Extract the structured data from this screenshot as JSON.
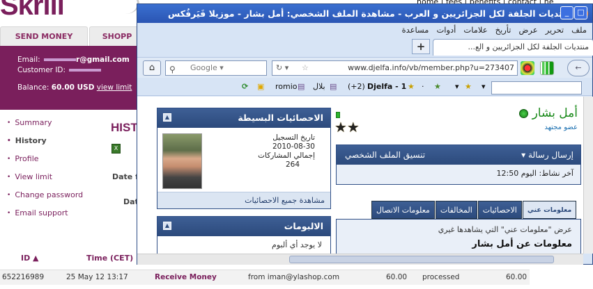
{
  "background": {
    "logo": "Skrill",
    "top_links": "home | fees | benefits | contact | he",
    "tabs": [
      "SEND MONEY",
      "SHOPP"
    ],
    "account": {
      "email_label": "Email:",
      "email_suffix": "r@gmail.com",
      "customer_label": "Customer ID:",
      "balance_label": "Balance:",
      "balance_value": "60.00 USD",
      "view_limit": "view limit"
    },
    "menu": [
      "Summary",
      "History",
      "Profile",
      "View limit",
      "Change password",
      "Email support"
    ],
    "page_title": "HIST",
    "date_from": "Date fr",
    "date_to": "Dat",
    "table_headers": {
      "id": "ID ▲",
      "time": "Time (CET)"
    },
    "row": {
      "id": "652216989",
      "time": "25 May 12 13:17",
      "type": "Receive Money",
      "detail": "from iman@ylashop.com",
      "amount": "60.00",
      "status": "processed",
      "balance": "60.00"
    }
  },
  "browser": {
    "title": "منتديات الجلفة لكل الجزائريين و العرب - مشاهدة الملف الشخصي: أمل بشار - موزيلا فَيَرفُكس",
    "menu": [
      "ملف",
      "تحرير",
      "عرض",
      "تأريخ",
      "علامات",
      "أدوات",
      "مساعدة"
    ],
    "tab_title": "منتديات الجلفة لكل الجزائريين و الع...",
    "new_tab": "+",
    "search_engine": "Google",
    "url": "www.djelfa.info/vb/member.php?u=273407",
    "bookmarks": {
      "romio": "romio",
      "bilal": "بلال",
      "count": "(+2)",
      "djelfa": "Djelfa - 1"
    }
  },
  "profile": {
    "stats_title": "الاحصائيات البسيطة",
    "join_label": "تاريخ التسجيل",
    "join_date": "2010-08-30",
    "posts_label": "إجمالي المشاركات",
    "posts_value": "264",
    "stats_footer": "مشاهدة جميع الاحصائيات",
    "albums_title": "الالبومات",
    "albums_empty": "لا يوجد أي ألبوم",
    "name": "أمل بشار",
    "member_title": "عضو مجتهد",
    "send_message": "إرسال رسالة",
    "profile_format": "تنسيق الملف الشخصي",
    "last_activity": "آخر نشاط: اليوم 12:50",
    "tabs": [
      "معلومات عني",
      "الاحصائيات",
      "المخالفات",
      "معلومات الاتصال"
    ],
    "about_desc": "عرض \"معلومات عني\" التي يشاهدها غيري",
    "about_title": "معلومات عن أمل بشار"
  }
}
